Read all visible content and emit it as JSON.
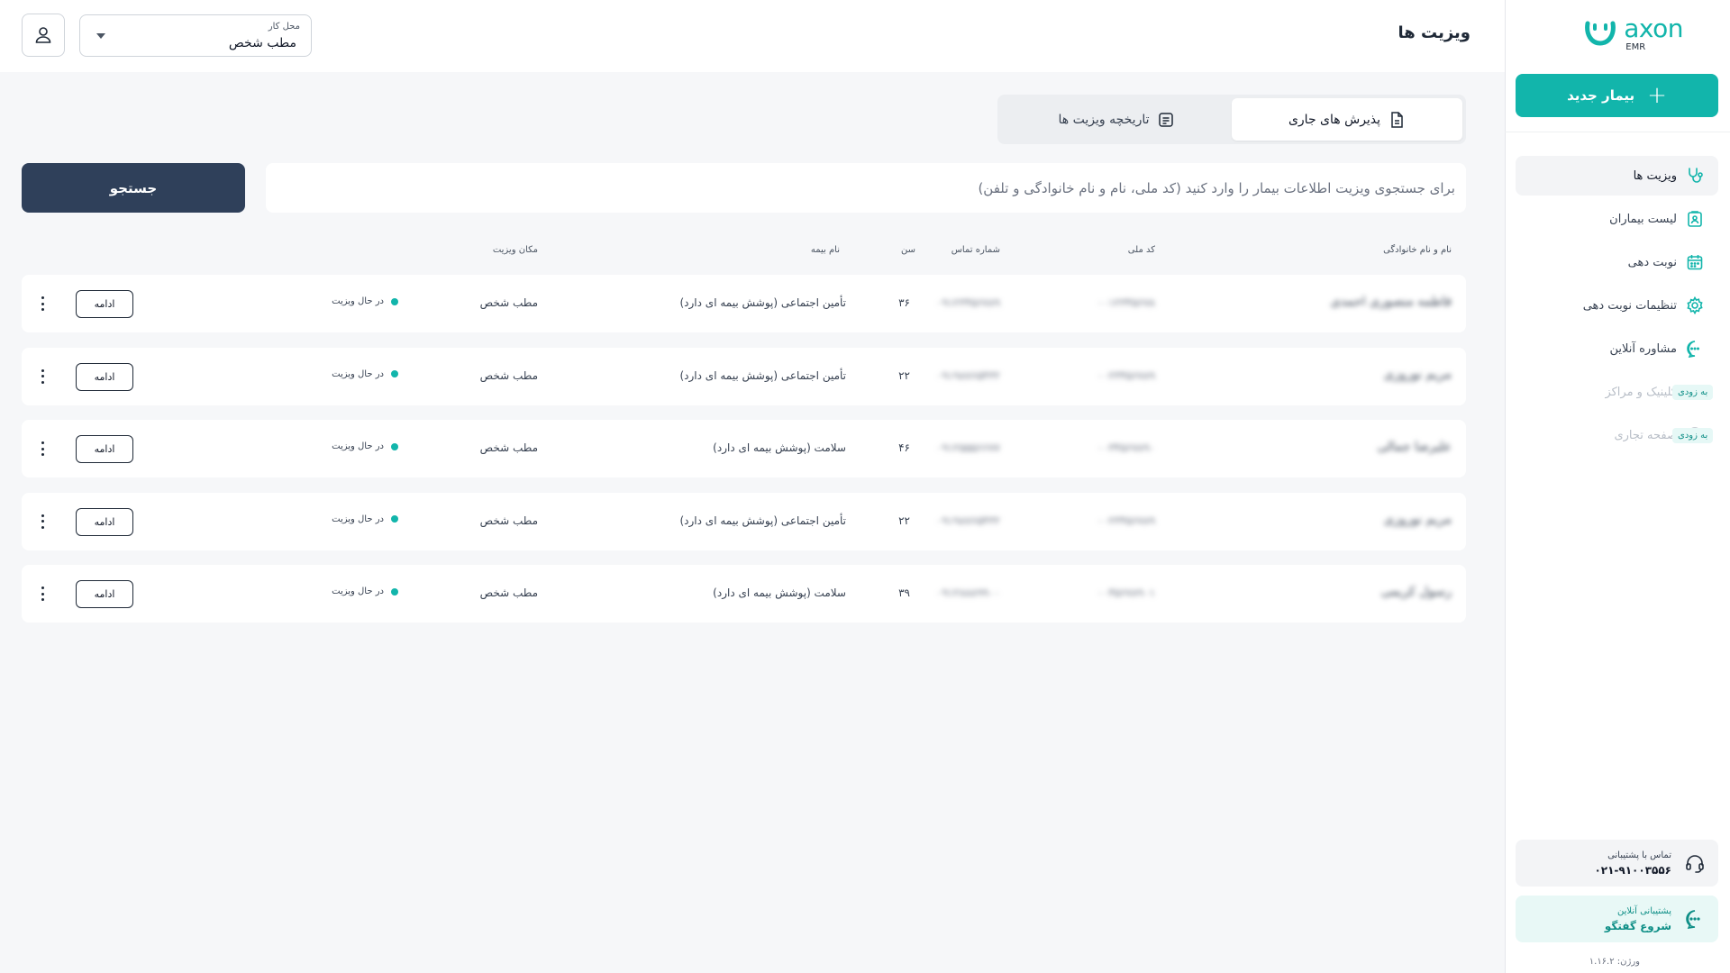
{
  "app": {
    "logo_word": "axon",
    "logo_sub": "EMR"
  },
  "sidebar": {
    "new_patient_label": "بیمار جدید",
    "items": [
      {
        "label": "ویزیت ها",
        "icon": "stethoscope-icon",
        "active": true
      },
      {
        "label": "لیست بیماران",
        "icon": "patient-list-icon"
      },
      {
        "label": "نوبت دهی",
        "icon": "calendar-icon"
      },
      {
        "label": "تنظیمات نوبت دهی",
        "icon": "gear-icon"
      },
      {
        "label": "مشاوره آنلاین",
        "icon": "chat-bubble-icon"
      },
      {
        "label": "کلینیک و مراکز",
        "icon": "building-icon",
        "disabled": true,
        "badge": "به زودی"
      },
      {
        "label": "صفحه تجاری",
        "icon": "globe-icon",
        "disabled": true,
        "badge": "به زودی"
      }
    ],
    "support_phone_title": "تماس با پشتیبانی",
    "support_phone": "۰۲۱-۹۱۰۰۳۵۵۶",
    "support_chat_title": "پشتیبانی آنلاین",
    "support_chat": "شروع گفتگو",
    "version": "ورژن: ۱.۱۶.۲"
  },
  "header": {
    "title": "ویزیت ها",
    "workplace_label": "محل کار",
    "workplace_value": "مطب شخص"
  },
  "tabs": [
    {
      "label": "پذیرش های جاری",
      "active": true
    },
    {
      "label": "تاریخچه ویزیت ها"
    }
  ],
  "search": {
    "placeholder": "برای جستجوی ویزیت اطلاعات بیمار را وارد کنید (کد ملی، نام و نام خانوادگی و تلفن)",
    "button_label": "جستجو"
  },
  "table": {
    "headers": {
      "name": "نام و نام خانوادگی",
      "national_id": "کد ملی",
      "phone": "شماره تماس",
      "age": "سن",
      "insurance": "نام بیمه",
      "location": "مکان ویزیت"
    },
    "continue_label": "ادامه",
    "rows": [
      {
        "name": "فاطمه منصوری احمدی",
        "national_id": "۰۰۱۲۳۴۵۶۷۸",
        "phone": "۰۹۱۲۳۴۵۶۷۸۹",
        "age": "۳۶",
        "insurance": "تأمین اجتماعی (پوشش بیمه ای دارد)",
        "location": "مطب شخص",
        "status": "در حال ویزیت"
      },
      {
        "name": "مریم نوروزی",
        "national_id": "۰۰۲۳۴۵۶۷۸۹",
        "phone": "۰۹۱۹۸۷۶۵۴۳۲",
        "age": "۲۲",
        "insurance": "تأمین اجتماعی (پوشش بیمه ای دارد)",
        "location": "مطب شخص",
        "status": "در حال ویزیت"
      },
      {
        "name": "علیرضا جمالی",
        "national_id": "۰۰۳۴۵۶۷۸۹۰",
        "phone": "۰۹۱۲۵۵۵۶۶۷۷",
        "age": "۴۶",
        "insurance": "سلامت (پوشش بیمه ای دارد)",
        "location": "مطب شخص",
        "status": "در حال ویزیت"
      },
      {
        "name": "مریم نوروزی",
        "national_id": "۰۰۲۳۴۵۶۷۸۹",
        "phone": "۰۹۱۹۸۷۶۵۴۳۲",
        "age": "۲۲",
        "insurance": "تأمین اجتماعی (پوشش بیمه ای دارد)",
        "location": "مطب شخص",
        "status": "در حال ویزیت"
      },
      {
        "name": "رسول کریمی",
        "national_id": "۰۰۴۵۶۷۸۹۰۱",
        "phone": "۰۹۱۲۸۸۸۹۹۰۰",
        "age": "۳۹",
        "insurance": "سلامت (پوشش بیمه ای دارد)",
        "location": "مطب شخص",
        "status": "در حال ویزیت"
      }
    ]
  },
  "colors": {
    "accent": "#12b5ab",
    "search_button": "#2f405a",
    "background": "#f6f7f9"
  }
}
